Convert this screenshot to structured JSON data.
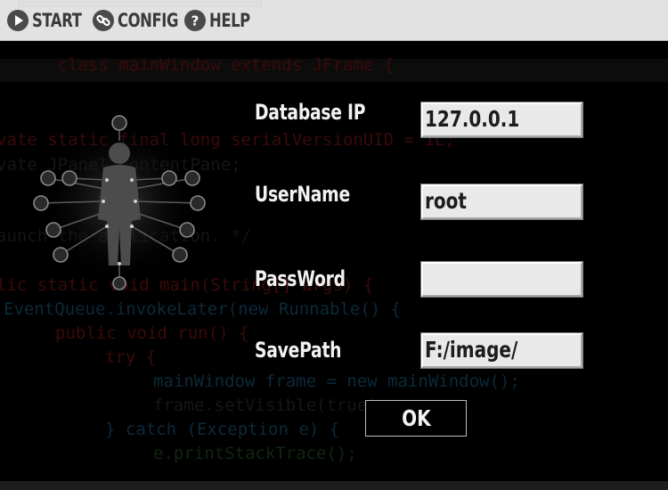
{
  "menu": {
    "items": [
      {
        "label": "START",
        "icon": "play-icon"
      },
      {
        "label": "CONFIG",
        "icon": "link-icon"
      },
      {
        "label": "HELP",
        "icon": "question-icon"
      }
    ]
  },
  "background_code": {
    "lines": [
      "class mainWindow extends JFrame {",
      "vate static final long serialVersionUID = 1L;",
      "vate JPanel contentPane;",
      "aunch the application. */",
      "lic static void main(String[] args) {",
      "EventQueue.invokeLater(new Runnable() {",
      "public void run() {",
      "try {",
      "mainWindow frame = new mainWindow();",
      "frame.setVisible(true);",
      "} catch (Exception e) {",
      "e.printStackTrace();"
    ]
  },
  "form": {
    "database_ip": {
      "label": "Database IP",
      "value": "127.0.0.1"
    },
    "username": {
      "label": "UserName",
      "value": "root"
    },
    "password": {
      "label": "PassWord",
      "value": ""
    },
    "save_path": {
      "label": "SavePath",
      "value": "F:/image/"
    },
    "ok_label": "OK"
  },
  "colors": {
    "menubar_bg": "#e2e2e2",
    "background": "#000000",
    "label_text": "#f2f2f2",
    "input_bg": "#e9e9e9"
  }
}
